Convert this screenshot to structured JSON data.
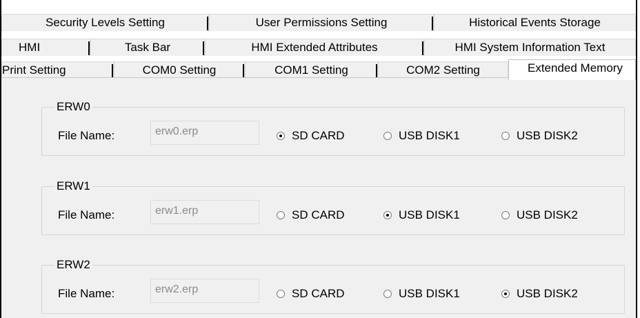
{
  "tabs": {
    "row1": [
      "Security Levels Setting",
      "User Permissions Setting",
      "Historical Events Storage"
    ],
    "row2": [
      "HMI",
      "Task Bar",
      "HMI Extended Attributes",
      "HMI System Information Text"
    ],
    "row3": [
      "Print Setting",
      "COM0 Setting",
      "COM1 Setting",
      "COM2 Setting",
      "Extended Memory"
    ],
    "active": "Extended Memory"
  },
  "file_name_label": "File Name:",
  "radio_options": [
    "SD CARD",
    "USB DISK1",
    "USB DISK2"
  ],
  "groups": [
    {
      "title": "ERW0",
      "file_name": "erw0.erp",
      "selected": "SD CARD"
    },
    {
      "title": "ERW1",
      "file_name": "erw1.erp",
      "selected": "USB DISK1"
    },
    {
      "title": "ERW2",
      "file_name": "erw2.erp",
      "selected": "USB DISK2"
    }
  ]
}
